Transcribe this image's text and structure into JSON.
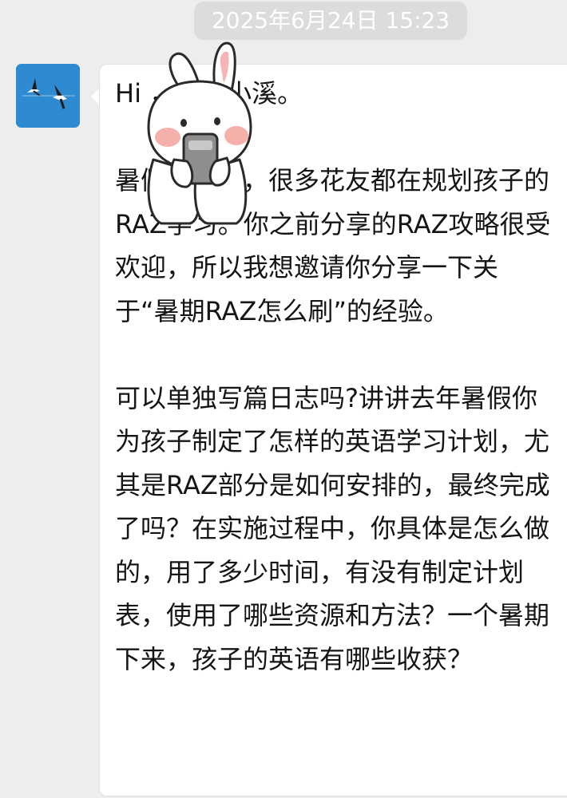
{
  "chat": {
    "timestamp": "2025年6月24日 15:23",
    "message": {
      "greeting": "Hi ，我是小溪。",
      "paragraph1": "暑假快到了，很多花友都在规划孩子的RAZ学习。你之前分享的RAZ攻略很受欢迎，所以我想邀请你分享一下关于“暑期RAZ怎么刷”的经验。",
      "paragraph2": "可以单独写篇日志吗?讲讲去年暑假你为孩子制定了怎样的英语学习计划，尤其是RAZ部分是如何安排的，最终完成了吗？在实施过程中，你具体是怎么做的，用了多少时间，有没有制定计划表，使用了哪些资源和方法？一个暑期下来，孩子的英语有哪些收获？"
    },
    "sender_avatar": {
      "icon": "crane-birds-avatar",
      "color": "#2e8bd1"
    },
    "sticker": {
      "icon": "bunny-holding-phone-sticker"
    }
  }
}
